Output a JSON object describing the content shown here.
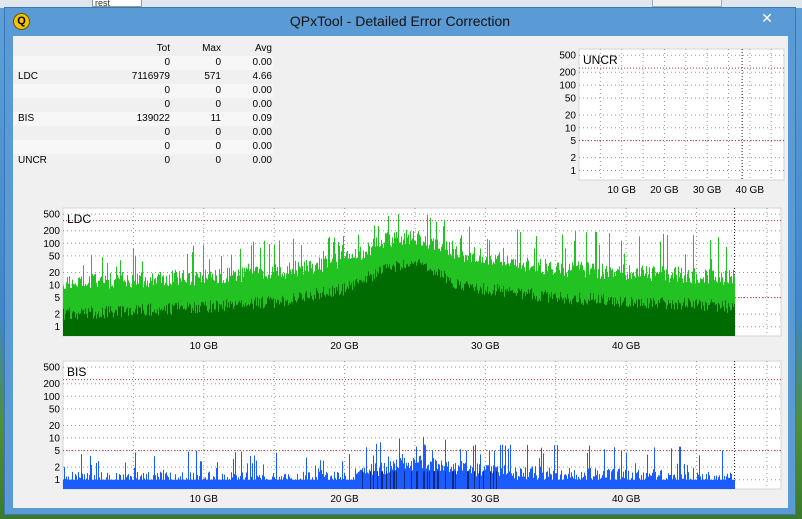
{
  "background": {
    "tab_label": "rest"
  },
  "window": {
    "title": "QPxTool - Detailed Error Correction",
    "icon_letter": "Q",
    "close_glyph": "✕"
  },
  "table": {
    "headers": {
      "name": "",
      "tot": "Tot",
      "max": "Max",
      "avg": "Avg"
    },
    "rows": [
      {
        "name": "",
        "tot": "0",
        "max": "0",
        "avg": "0.00"
      },
      {
        "name": "LDC",
        "tot": "7116979",
        "max": "571",
        "avg": "4.66"
      },
      {
        "name": "",
        "tot": "0",
        "max": "0",
        "avg": "0.00"
      },
      {
        "name": "",
        "tot": "0",
        "max": "0",
        "avg": "0.00"
      },
      {
        "name": "BIS",
        "tot": "139022",
        "max": "11",
        "avg": "0.09"
      },
      {
        "name": "",
        "tot": "0",
        "max": "0",
        "avg": "0.00"
      },
      {
        "name": "",
        "tot": "0",
        "max": "0",
        "avg": "0.00"
      },
      {
        "name": "UNCR",
        "tot": "0",
        "max": "0",
        "avg": "0.00"
      }
    ]
  },
  "colors": {
    "ldc_light": "#22c222",
    "ldc_dark": "#006b00",
    "bis": "#1a5cff",
    "bis_dark": "#0a2a80",
    "threshold": "#cc3333",
    "grid": "#9a9a9a"
  },
  "chart_data": [
    {
      "type": "bar",
      "title": "UNCR",
      "x_ticks": [
        10,
        20,
        30,
        40
      ],
      "x_tick_labels": [
        "10 GB",
        "20 GB",
        "30 GB",
        "40 GB"
      ],
      "y_ticks": [
        1,
        2,
        5,
        10,
        20,
        50,
        100,
        200,
        500
      ],
      "y_scale": "log",
      "xlim": [
        0,
        48
      ],
      "ylim": [
        0.6,
        700
      ],
      "thresholds": [
        5,
        250
      ],
      "disc_end_gb": 38.2,
      "series": [
        {
          "values": []
        }
      ],
      "grid": true
    },
    {
      "type": "bar",
      "title": "LDC",
      "x_ticks": [
        10,
        20,
        30,
        40
      ],
      "x_tick_labels": [
        "10 GB",
        "20 GB",
        "30 GB",
        "40 GB"
      ],
      "y_ticks": [
        1,
        2,
        5,
        10,
        20,
        50,
        100,
        200,
        500
      ],
      "y_scale": "log",
      "xlim": [
        0,
        51
      ],
      "ylim": [
        0.6,
        700
      ],
      "thresholds": [
        5,
        350
      ],
      "disc_end_gb": 47.7,
      "max_value": 571,
      "profile": [
        {
          "gb": 0,
          "peak": 60,
          "base": 12,
          "dark": 2
        },
        {
          "gb": 10,
          "peak": 90,
          "base": 15,
          "dark": 3
        },
        {
          "gb": 15,
          "peak": 120,
          "base": 20,
          "dark": 4
        },
        {
          "gb": 20,
          "peak": 150,
          "base": 40,
          "dark": 8
        },
        {
          "gb": 23,
          "peak": 450,
          "base": 120,
          "dark": 25
        },
        {
          "gb": 25,
          "peak": 571,
          "base": 150,
          "dark": 40
        },
        {
          "gb": 28,
          "peak": 300,
          "base": 60,
          "dark": 10
        },
        {
          "gb": 35,
          "peak": 200,
          "base": 25,
          "dark": 5
        },
        {
          "gb": 47.7,
          "peak": 150,
          "base": 15,
          "dark": 3
        }
      ],
      "grid": true
    },
    {
      "type": "bar",
      "title": "BIS",
      "x_ticks": [
        10,
        20,
        30,
        40
      ],
      "x_tick_labels": [
        "10 GB",
        "20 GB",
        "30 GB",
        "40 GB"
      ],
      "y_ticks": [
        1,
        2,
        5,
        10,
        20,
        50,
        100,
        200,
        500
      ],
      "y_scale": "log",
      "xlim": [
        0,
        51
      ],
      "ylim": [
        0.6,
        700
      ],
      "thresholds": [
        5,
        250
      ],
      "disc_end_gb": 47.7,
      "max_value": 11,
      "profile": [
        {
          "gb": 0,
          "peak": 4,
          "base": 1
        },
        {
          "gb": 10,
          "peak": 5,
          "base": 1
        },
        {
          "gb": 20,
          "peak": 4,
          "base": 1
        },
        {
          "gb": 23,
          "peak": 9,
          "base": 2
        },
        {
          "gb": 26,
          "peak": 11,
          "base": 2.5
        },
        {
          "gb": 30,
          "peak": 7,
          "base": 1.5
        },
        {
          "gb": 47.7,
          "peak": 6,
          "base": 1
        }
      ],
      "grid": true
    }
  ]
}
